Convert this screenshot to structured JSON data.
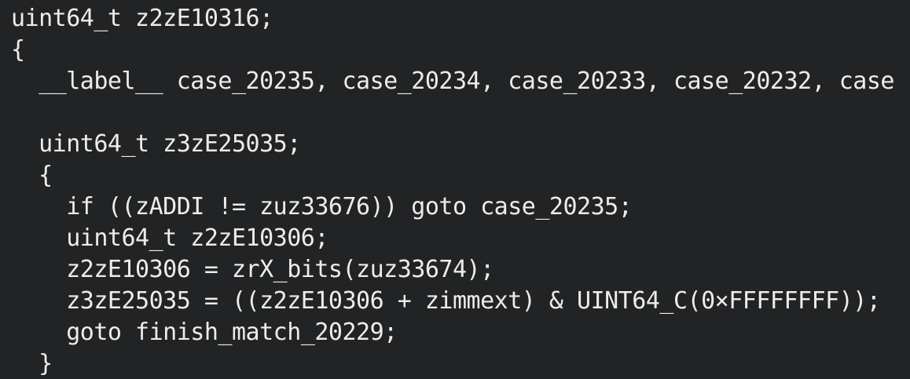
{
  "editor": {
    "lines": [
      "uint64_t z2zE10316;",
      "{",
      "  __label__ case_20235, case_20234, case_20233, case_20232, case",
      "",
      "  uint64_t z3zE25035;",
      "  {",
      "    if ((zADDI != zuz33676)) goto case_20235;",
      "    uint64_t z2zE10306;",
      "    z2zE10306 = zrX_bits(zuz33674);",
      "    z3zE25035 = ((z2zE10306 + zimmext) & UINT64_C(0×FFFFFFFF));",
      "    goto finish_match_20229;",
      "  }"
    ],
    "colors": {
      "background": "#222324",
      "text": "#ececec"
    }
  }
}
